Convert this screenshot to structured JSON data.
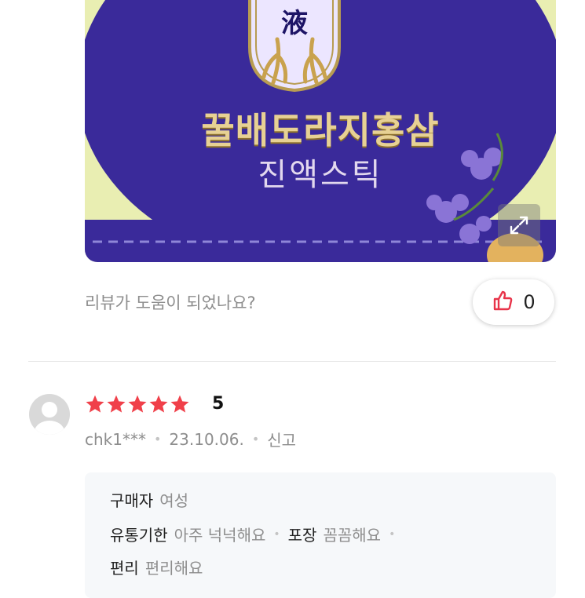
{
  "photo": {
    "emblem_char": "液",
    "product_name_line1": "꿀배도라지홍삼",
    "product_name_line2": "진액스틱"
  },
  "helpful": {
    "question": "리뷰가 도움이 되었나요?",
    "count": "0"
  },
  "review": {
    "rating": "5",
    "stars": 5,
    "username": "chk1***",
    "date": "23.10.06.",
    "report_label": "신고"
  },
  "survey": {
    "rows": [
      [
        {
          "key": "구매자",
          "value": "여성"
        }
      ],
      [
        {
          "key": "유통기한",
          "value": "아주 넉넉해요"
        },
        {
          "key": "포장",
          "value": "꼼꼼해요"
        }
      ],
      [
        {
          "key": "편리",
          "value": "편리해요"
        }
      ]
    ]
  },
  "colors": {
    "star": "#f0404a",
    "like_icon": "#e8344a",
    "box_purple": "#3a2a9a",
    "muted_text": "#8d8d8d"
  },
  "icons": [
    "expand-icon",
    "thumbs-up-icon",
    "star-icon",
    "avatar-icon"
  ]
}
